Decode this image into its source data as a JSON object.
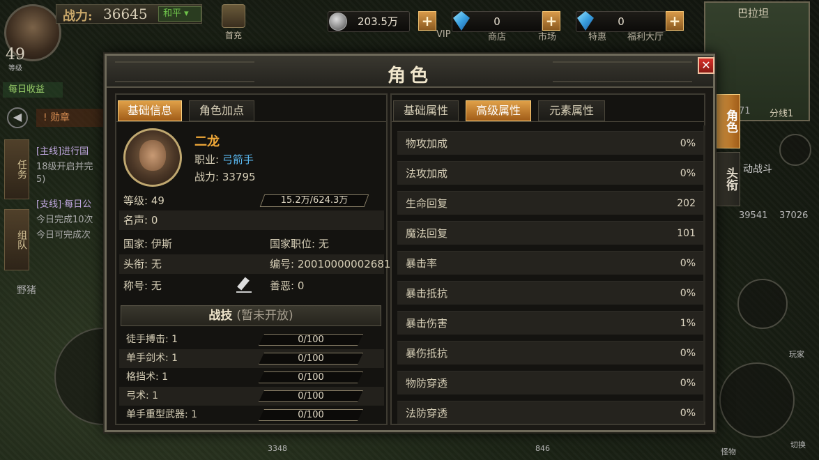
{
  "hud": {
    "power_label": "战力:",
    "power_value": "36645",
    "peace_mode": "和平",
    "first_charge": "首充",
    "level": "49",
    "level_label": "等级",
    "daily_income": "每日收益",
    "medal": "勋章",
    "task_tab": "任务",
    "team_tab": "组队",
    "quest1": "[主线]进行国",
    "quest2": "18级开启并完",
    "quest3": "5)",
    "quest4": "[支线]·每日公",
    "quest5": "今日完成10次",
    "quest6": "今日可完成次",
    "wild_boar": "野猪",
    "silver": "203.5万",
    "gem1": "0",
    "gem2": "0",
    "vip": "VIP",
    "shop": "商店",
    "market": "市场",
    "special": "特惠",
    "welfare": "福利大厅",
    "minimap_title": "巴拉坦",
    "minimap_line": "分线1",
    "minimap_num": "71",
    "auto_battle": "动战斗",
    "hp_pot": "39541",
    "mp_pot": "37026",
    "player_label": "玩家",
    "monster_label": "怪物",
    "switch_label": "切换",
    "bottom_hp": "3348",
    "bottom_mp": "846"
  },
  "dialog": {
    "title": "角色",
    "close": "✕",
    "left_tabs": [
      "基础信息",
      "角色加点"
    ],
    "right_tabs": [
      "基础属性",
      "高级属性",
      "元素属性"
    ],
    "side_tabs": [
      "角色",
      "头衔"
    ]
  },
  "character": {
    "name": "二龙",
    "class_label": "职业:",
    "class_value": "弓箭手",
    "power_label": "战力:",
    "power_value": "33795",
    "level": "等级: 49",
    "exp": "15.2万/624.3万",
    "exp_progress": 0.024,
    "fame": "名声: 0",
    "nation": "国家: 伊斯",
    "nation_title": "国家职位: 无",
    "title": "头衔: 无",
    "id": "编号: 20010000002681",
    "nickname": "称号: 无",
    "karma": "善恶: 0"
  },
  "skills": {
    "header": "战技",
    "header_note": "(暂未开放)",
    "items": [
      {
        "label": "徒手搏击: 1",
        "progress": "0/100"
      },
      {
        "label": "单手剑术: 1",
        "progress": "0/100"
      },
      {
        "label": "格挡术: 1",
        "progress": "0/100"
      },
      {
        "label": "弓术: 1",
        "progress": "0/100"
      },
      {
        "label": "单手重型武器: 1",
        "progress": "0/100"
      }
    ]
  },
  "attributes": [
    {
      "label": "物攻加成",
      "value": "0%"
    },
    {
      "label": "法攻加成",
      "value": "0%"
    },
    {
      "label": "生命回复",
      "value": "202"
    },
    {
      "label": "魔法回复",
      "value": "101"
    },
    {
      "label": "暴击率",
      "value": "0%"
    },
    {
      "label": "暴击抵抗",
      "value": "0%"
    },
    {
      "label": "暴击伤害",
      "value": "1%"
    },
    {
      "label": "暴伤抵抗",
      "value": "0%"
    },
    {
      "label": "物防穿透",
      "value": "0%"
    },
    {
      "label": "法防穿透",
      "value": "0%"
    }
  ],
  "colors": {
    "accent_orange": "#e0a048",
    "name_gold": "#f0a838",
    "class_blue": "#5ab8f0",
    "close_red": "#d8302a"
  }
}
